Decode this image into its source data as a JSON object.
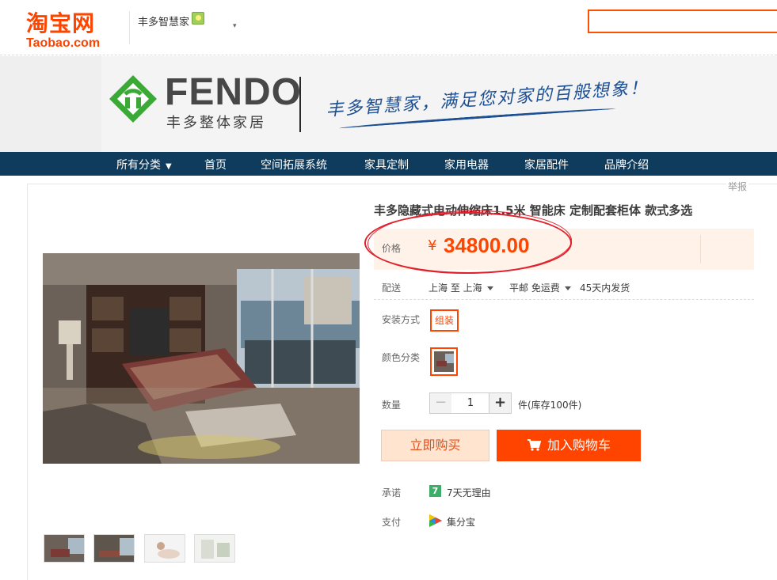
{
  "header": {
    "logo_cn": "淘宝网",
    "logo_en": "Taobao.com",
    "shop_name": "丰多智慧家",
    "dropdown_glyph": "▾"
  },
  "banner": {
    "brand_name": "FENDO",
    "brand_sub": "丰多整体家居",
    "slogan": "丰多智慧家，满足您对家的百般想象！"
  },
  "nav": {
    "items": [
      "所有分类",
      "首页",
      "空间拓展系统",
      "家具定制",
      "家用电器",
      "家居配件",
      "品牌介绍"
    ]
  },
  "report": "举报",
  "product": {
    "title": "丰多隐藏式电动伸缩床1.5米 智能床 定制配套柜体 款式多选",
    "price_label": "价格",
    "currency": "¥",
    "price": "34800.00",
    "delivery_label": "配送",
    "delivery_route": "上海 至 上海",
    "delivery_shipping": "平邮 免运费",
    "delivery_time": "45天内发货",
    "install_label": "安装方式",
    "install_option": "组装",
    "color_label": "颜色分类",
    "qty_label": "数量",
    "qty_minus": "−",
    "qty_value": "1",
    "qty_plus": "+",
    "qty_unit": "件(库存100件)",
    "buy_now": "立即购买",
    "add_cart": "加入购物车",
    "promise_label": "承诺",
    "promise_icon": "7",
    "promise_text": "7天无理由",
    "pay_label": "支付",
    "pay_text": "集分宝"
  },
  "colors": {
    "accent": "#ff4400",
    "nav_bg": "#0f3b5c",
    "annotation": "#e0202c"
  },
  "icons": {
    "cart": "cart-icon",
    "pay": "jifenbao-icon",
    "promise": "seven-day-icon"
  }
}
